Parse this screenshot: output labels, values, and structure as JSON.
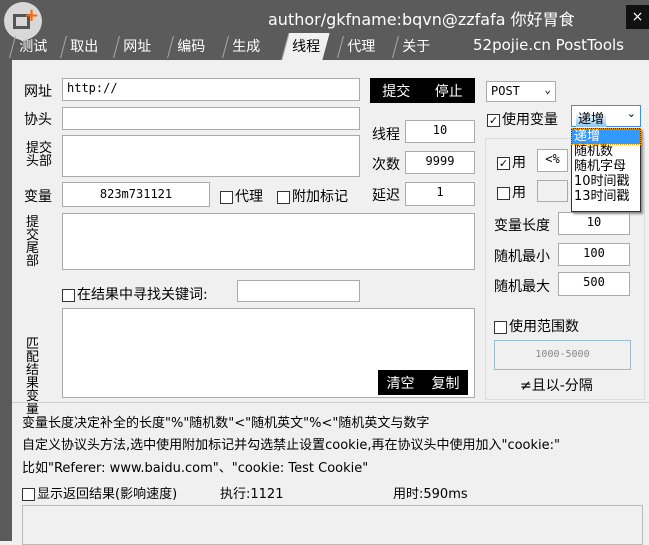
{
  "window": {
    "title": "author/gkfname:bqvn@zzfafa 你好胃食",
    "close": "×",
    "brand": "52pojie.cn  PostTools"
  },
  "tabs": [
    "测试",
    "取出",
    "网址",
    "编码",
    "生成",
    "线程",
    "代理",
    "关于"
  ],
  "active_tab": "线程",
  "form": {
    "url_label": "网址",
    "url_value": "http://",
    "submit": "提交",
    "stop": "停止",
    "header_label": "协头",
    "submit_head_label": "提交头部",
    "threads_label": "线程",
    "threads": "10",
    "count_label": "次数",
    "count": "9999",
    "delay_label": "延迟",
    "delay": "1",
    "var_label": "变量",
    "var_value": "823m731121",
    "proxy_label": "代理",
    "tag_label": "附加标记",
    "tail_label": "提交尾部",
    "find_label": "在结果中寻找关键词:",
    "match_label": "匹配结果变量",
    "clear": "清空",
    "copy": "复制"
  },
  "right": {
    "method": "POST",
    "use_var_label": "使用变量",
    "var_mode": "递增",
    "var_mode_options": [
      "递增",
      "随机数",
      "随机字母",
      "10时间戳",
      "13时间戳"
    ],
    "use1_label": "用",
    "use1_value": "<%",
    "use2_label": "用",
    "use2_value": "",
    "var_len_label": "变量长度",
    "var_len": "10",
    "rand_min_label": "随机最小",
    "rand_min": "100",
    "rand_max_label": "随机最大",
    "rand_max": "500",
    "range_label": "使用范围数",
    "range_value": "1000-5000",
    "range_hint": "≠且以-分隔"
  },
  "notes": [
    "变量长度决定补全的长度\"%\"随机数\"<\"随机英文\"%<\"随机英文与数字",
    "自定义协议头方法,选中使用附加标记并勾选禁止设置cookie,再在协议头中使用加入\"cookie:\"",
    "比如\"Referer: www.baidu.com\"、\"cookie: Test Cookie\""
  ],
  "status": {
    "show_result_label": "显示返回结果(影响速度)",
    "exec": "执行:1121",
    "time": "用时:590ms"
  }
}
